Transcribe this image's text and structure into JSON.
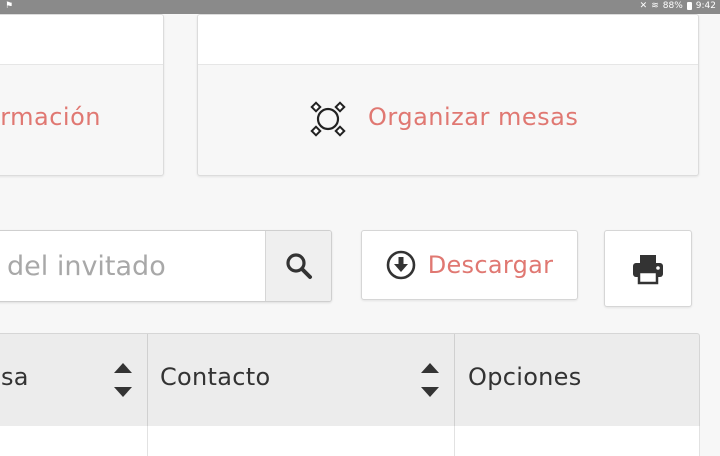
{
  "statusbar": {
    "battery": "88%",
    "time": "9:42"
  },
  "cards": {
    "info_label": "rmación",
    "tables_label": "Organizar mesas"
  },
  "search": {
    "placeholder": "del invitado"
  },
  "actions": {
    "download_label": "Descargar"
  },
  "table": {
    "headers": [
      "sa",
      "Contacto",
      "Opciones"
    ]
  },
  "colors": {
    "accent": "#e07872",
    "statusbar": "#8a8a8a",
    "header_bg": "#ececec"
  },
  "icons": [
    "round-table-icon",
    "search-icon",
    "download-circle-icon",
    "printer-icon",
    "sort-icon"
  ]
}
